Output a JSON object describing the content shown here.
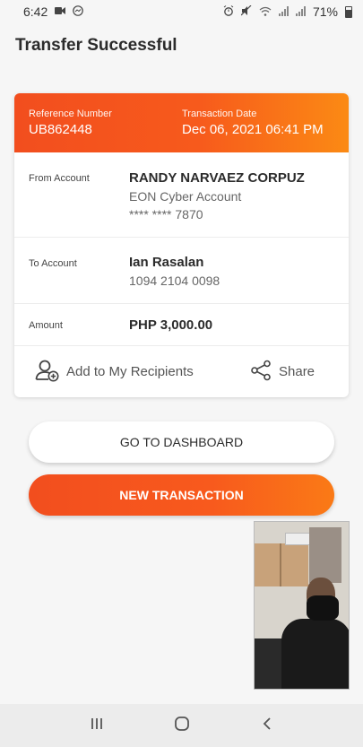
{
  "status_bar": {
    "time": "6:42",
    "battery": "71%",
    "left_icons": [
      "video-call-icon",
      "messenger-icon"
    ],
    "right_icons": [
      "alarm-icon",
      "mute-icon",
      "wifi-icon",
      "signal-icon",
      "signal-icon",
      "battery-icon"
    ]
  },
  "page": {
    "title": "Transfer Successful"
  },
  "card": {
    "reference": {
      "label": "Reference Number",
      "value": "UB862448"
    },
    "date": {
      "label": "Transaction Date",
      "value": "Dec 06, 2021 06:41 PM"
    },
    "from": {
      "label": "From Account",
      "name": "RANDY NARVAEZ CORPUZ",
      "account_type": "EON Cyber Account",
      "account_number": "**** **** 7870"
    },
    "to": {
      "label": "To Account",
      "name": "Ian Rasalan",
      "account_number": "1094 2104 0098"
    },
    "amount": {
      "label": "Amount",
      "value": "PHP 3,000.00"
    },
    "actions": {
      "add_recipient": "Add to My Recipients",
      "share": "Share"
    }
  },
  "buttons": {
    "dashboard": "GO TO DASHBOARD",
    "new_transaction": "NEW TRANSACTION"
  },
  "colors": {
    "accent_start": "#f24e1e",
    "accent_end": "#fb8a14",
    "background": "#f6f6f6"
  },
  "nav": [
    "recent-apps-icon",
    "home-icon",
    "back-icon"
  ]
}
